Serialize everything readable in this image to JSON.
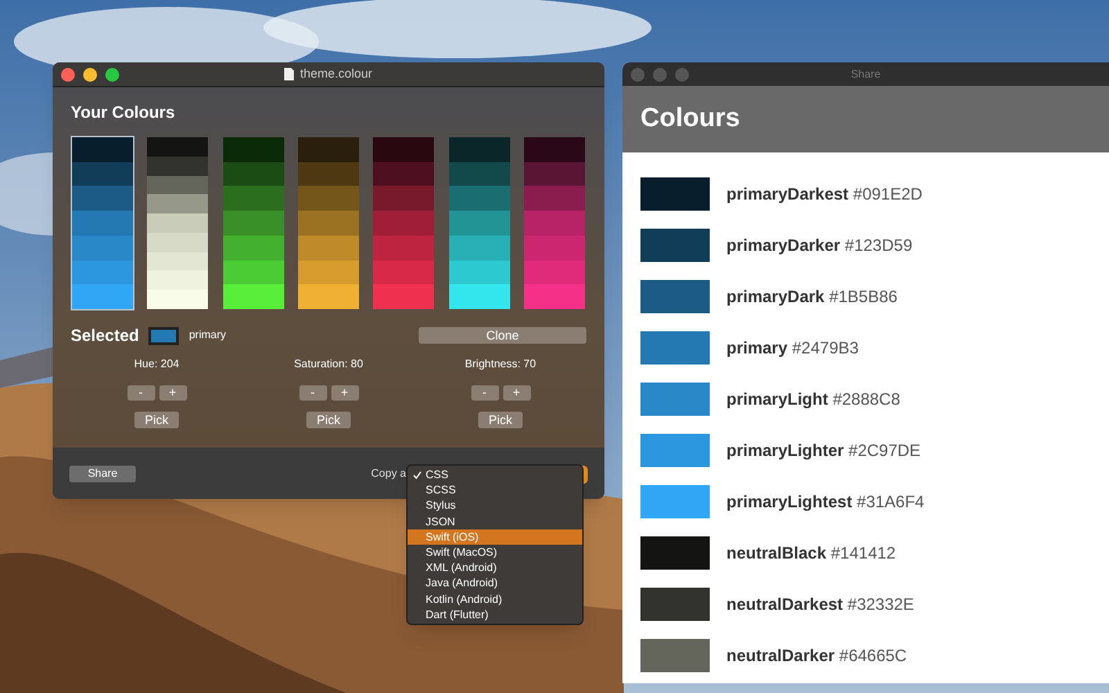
{
  "editor": {
    "title": "theme.colour",
    "heading": "Your Colours",
    "palettes": [
      {
        "selected": true,
        "swatches": [
          {
            "color": "#091e2d"
          },
          {
            "color": "#123d59"
          },
          {
            "color": "#1b5b86"
          },
          {
            "color": "#2479b3"
          },
          {
            "color": "#2888c8"
          },
          {
            "color": "#2c97de"
          },
          {
            "color": "#31a6f4"
          }
        ]
      },
      {
        "selected": false,
        "swatches": [
          {
            "color": "#141412"
          },
          {
            "color": "#32332e"
          },
          {
            "color": "#64665c"
          },
          {
            "color": "#96998a"
          },
          {
            "color": "#c8ccb8"
          },
          {
            "color": "#d6dac6"
          },
          {
            "color": "#e2e6d2"
          },
          {
            "color": "#eef2de"
          },
          {
            "color": "#f8fce8"
          }
        ]
      },
      {
        "selected": false,
        "swatches": [
          {
            "color": "#0a2a08"
          },
          {
            "color": "#1a4c14"
          },
          {
            "color": "#2a6e1e"
          },
          {
            "color": "#3a9028"
          },
          {
            "color": "#44b030"
          },
          {
            "color": "#4ccc34"
          },
          {
            "color": "#58ee3a"
          }
        ]
      },
      {
        "selected": false,
        "swatches": [
          {
            "color": "#2a1e0c"
          },
          {
            "color": "#4e3812"
          },
          {
            "color": "#75561a"
          },
          {
            "color": "#9a7222"
          },
          {
            "color": "#be8a2a"
          },
          {
            "color": "#d89c2e"
          },
          {
            "color": "#efb033"
          }
        ]
      },
      {
        "selected": false,
        "swatches": [
          {
            "color": "#2a0810"
          },
          {
            "color": "#4e1020"
          },
          {
            "color": "#781a2c"
          },
          {
            "color": "#a01e38"
          },
          {
            "color": "#be2440"
          },
          {
            "color": "#d82a48"
          },
          {
            "color": "#f0304f"
          }
        ]
      },
      {
        "selected": false,
        "swatches": [
          {
            "color": "#0a2628"
          },
          {
            "color": "#124a4c"
          },
          {
            "color": "#1a6e72"
          },
          {
            "color": "#229496"
          },
          {
            "color": "#28b0b6"
          },
          {
            "color": "#2ccad0"
          },
          {
            "color": "#33e6ee"
          }
        ]
      },
      {
        "selected": false,
        "swatches": [
          {
            "color": "#2a0818"
          },
          {
            "color": "#5a1434"
          },
          {
            "color": "#8a1c4e"
          },
          {
            "color": "#b82266"
          },
          {
            "color": "#cc2670"
          },
          {
            "color": "#e02a7a"
          },
          {
            "color": "#f43088"
          }
        ]
      }
    ],
    "selected_label": "Selected",
    "selected_swatch": {
      "color": "#2479b3"
    },
    "selected_name": "primary",
    "clone_button": "Clone",
    "adjusters": [
      {
        "label": "Hue: 204",
        "minus": "-",
        "plus": "+",
        "pick": "Pick"
      },
      {
        "label": "Saturation: 80",
        "minus": "-",
        "plus": "+",
        "pick": "Pick"
      },
      {
        "label": "Brightness: 70",
        "minus": "-",
        "plus": "+",
        "pick": "Pick"
      }
    ],
    "share_button": "Share",
    "copy_label": "Copy a",
    "copy_menu": [
      {
        "label": "CSS",
        "checked": true,
        "selected": false
      },
      {
        "label": "SCSS",
        "checked": false,
        "selected": false
      },
      {
        "label": "Stylus",
        "checked": false,
        "selected": false
      },
      {
        "label": "JSON",
        "checked": false,
        "selected": false
      },
      {
        "label": "Swift (iOS)",
        "checked": false,
        "selected": true
      },
      {
        "label": "Swift (MacOS)",
        "checked": false,
        "selected": false
      },
      {
        "label": "XML (Android)",
        "checked": false,
        "selected": false
      },
      {
        "label": "Java (Android)",
        "checked": false,
        "selected": false
      },
      {
        "label": "Kotlin (Android)",
        "checked": false,
        "selected": false
      },
      {
        "label": "Dart (Flutter)",
        "checked": false,
        "selected": false
      }
    ]
  },
  "share": {
    "title": "Share",
    "heading": "Colours",
    "colours": [
      {
        "name": "primaryDarkest",
        "hex": "#091E2D",
        "color": "#091e2d"
      },
      {
        "name": "primaryDarker",
        "hex": "#123D59",
        "color": "#123d59"
      },
      {
        "name": "primaryDark",
        "hex": "#1B5B86",
        "color": "#1b5b86"
      },
      {
        "name": "primary",
        "hex": "#2479B3",
        "color": "#2479b3"
      },
      {
        "name": "primaryLight",
        "hex": "#2888C8",
        "color": "#2888c8"
      },
      {
        "name": "primaryLighter",
        "hex": "#2C97DE",
        "color": "#2c97de"
      },
      {
        "name": "primaryLightest",
        "hex": "#31A6F4",
        "color": "#31a6f4"
      },
      {
        "name": "neutralBlack",
        "hex": "#141412",
        "color": "#141412"
      },
      {
        "name": "neutralDarkest",
        "hex": "#32332E",
        "color": "#32332e"
      },
      {
        "name": "neutralDarker",
        "hex": "#64665C",
        "color": "#64665c"
      }
    ]
  }
}
